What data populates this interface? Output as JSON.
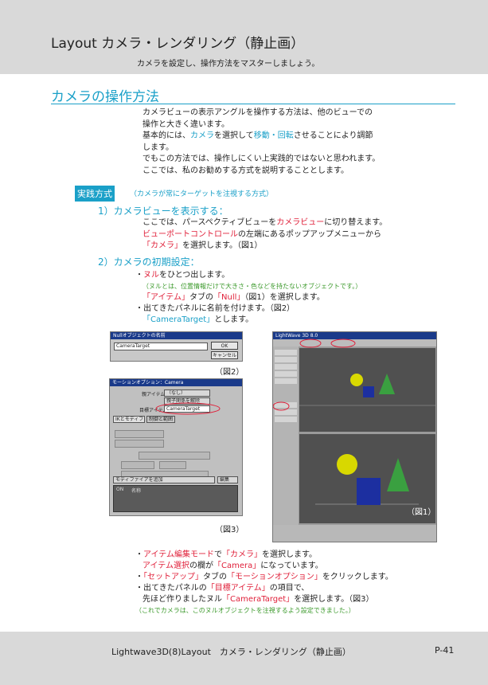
{
  "header": {
    "title": "Layout カメラ・レンダリング（静止画）",
    "subtitle": "カメラを設定し、操作方法をマスターしましょう。"
  },
  "section": {
    "title": "カメラの操作方法"
  },
  "intro": {
    "line1": "カメラビューの表示アングルを操作する方法は、他のビューでの",
    "line2": "操作と大きく違います。",
    "line3_a": "基本的には、",
    "line3_b": "カメラ",
    "line3_c": "を選択して",
    "line3_d": "移動・回転",
    "line3_e": "させることにより調節",
    "line4": "します。",
    "line5": "でもこの方法では、操作しにくい上実践的ではないと思われます。",
    "line6": "ここでは、私のお勧めする方式を説明することとします。"
  },
  "practice": {
    "badge": "実践方式",
    "note": "（カメラが常にターゲットを注視する方式）"
  },
  "step1": {
    "heading": "1）カメラビューを表示する：",
    "l1_a": "ここでは、パースペクティブビューを",
    "l1_b": "カメラビュー",
    "l1_c": "に切り替えます。",
    "l2_a": "ビューポートコントロール",
    "l2_b": "の左端にあるポップアップメニューから",
    "l3_a": "「カメラ」",
    "l3_b": "を選択します。（図1）"
  },
  "step2": {
    "heading": "2）カメラの初期設定：",
    "b1_a": "・",
    "b1_b": "ヌル",
    "b1_c": "をひとつ出します。",
    "b1_note": "（ヌルとは、位置情報だけで大きさ・色などを持たないオブジェクトです。）",
    "b1_l3_a": "「アイテム」",
    "b1_l3_b": "タブの",
    "b1_l3_c": "「Null」",
    "b1_l3_d": "（図1）を選択します。",
    "b2": "・出てきたパネルに名前を付けます。（図2）",
    "b2_l2_a": "「CameraTarget」",
    "b2_l2_b": "とします。"
  },
  "figures": {
    "fig1_caption": "（図1）",
    "fig2_caption": "（図2）",
    "fig3_caption": "（図3）",
    "fig2_title": "Nullオブジェクトの名前",
    "fig2_field": "CameraTarget",
    "fig2_ok": "OK",
    "fig2_cancel": "キャンセル",
    "fig3_title": "モーションオプション：Camera",
    "fig3_row1_label": "親アイテム",
    "fig3_row1_value": "（なし）",
    "fig3_row2_value": "親子関係を解除",
    "fig3_row3_label": "目標アイテム",
    "fig3_row3_value": "CameraTarget",
    "fig3_tab1": "IKとモディファイヤ",
    "fig3_tab2": "制御と範囲",
    "fig3_modifier": "モディファイアを追加",
    "fig3_edit": "編集",
    "fig3_col_on": "ON",
    "fig3_col_name": "名称",
    "fig1_title": "LightWave 3D 8.0"
  },
  "bottom": {
    "b1_a": "・",
    "b1_b": "アイテム編集モード",
    "b1_c": "で",
    "b1_d": "「カメラ」",
    "b1_e": "を選択します。",
    "b1_l2_a": "アイテム選択",
    "b1_l2_b": "の欄が",
    "b1_l2_c": "「Camera」",
    "b1_l2_d": "になっています。",
    "b2_a": "・",
    "b2_b": "「セットアップ」",
    "b2_c": "タブの",
    "b2_d": "「モーションオプション」",
    "b2_e": "をクリックします。",
    "b3_a": "・出てきたパネルの",
    "b3_b": "「目標アイテム」",
    "b3_c": "の項目で、",
    "b3_l2_a": "先ほど作りましたヌル",
    "b3_l2_b": "「CameraTarget」",
    "b3_l2_c": "を選択します。（図3）",
    "note": "（これでカメラは、このヌルオブジェクトを注視するよう設定できました。）"
  },
  "footer": {
    "left": "Lightwave3D(8)Layout　カメラ・レンダリング（静止画）",
    "right": "P-41"
  },
  "colors": {
    "accent_blue": "#1aa0c8",
    "accent_red": "#e0203a",
    "note_green": "#3c9a2c",
    "band_grey": "#d9d9d9"
  }
}
